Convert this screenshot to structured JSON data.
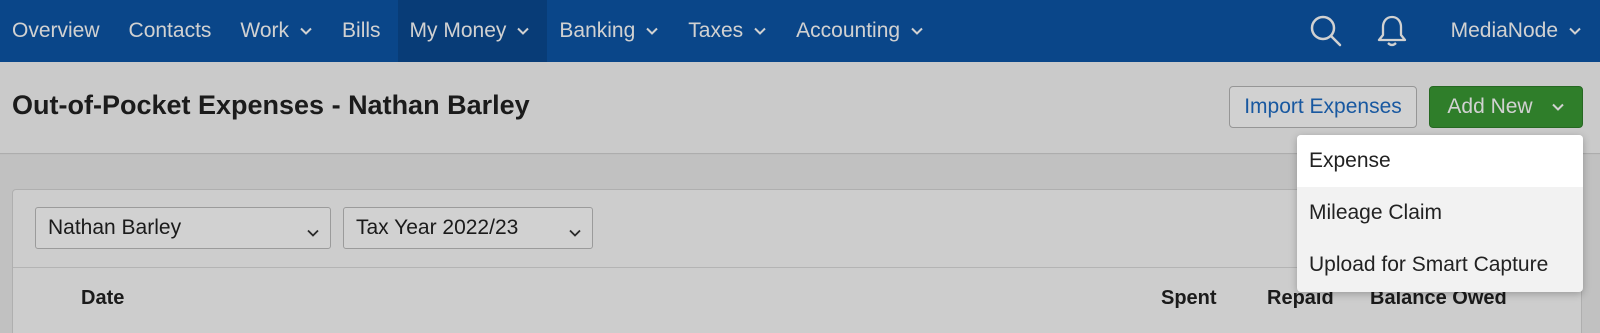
{
  "nav": {
    "items": [
      {
        "label": "Overview",
        "dropdown": false
      },
      {
        "label": "Contacts",
        "dropdown": false
      },
      {
        "label": "Work",
        "dropdown": true
      },
      {
        "label": "Bills",
        "dropdown": false
      },
      {
        "label": "My Money",
        "dropdown": true,
        "active": true
      },
      {
        "label": "Banking",
        "dropdown": true
      },
      {
        "label": "Taxes",
        "dropdown": true
      },
      {
        "label": "Accounting",
        "dropdown": true
      }
    ],
    "user": "MediaNode",
    "icons": [
      "search-icon",
      "bell-icon"
    ]
  },
  "header": {
    "title": "Out-of-Pocket Expenses - Nathan Barley",
    "import_label": "Import Expenses",
    "add_label": "Add New"
  },
  "filters": {
    "person": "Nathan Barley",
    "tax_year": "Tax Year 2022/23"
  },
  "table": {
    "columns": [
      "Date",
      "Spent",
      "Repaid",
      "Balance Owed"
    ]
  },
  "add_menu": {
    "items": [
      "Expense",
      "Mileage Claim",
      "Upload for Smart Capture"
    ],
    "highlighted": "Expense"
  },
  "colors": {
    "nav_bg": "#0d56a8",
    "add_button": "#3a9a34",
    "link_blue": "#1e6cc4"
  }
}
